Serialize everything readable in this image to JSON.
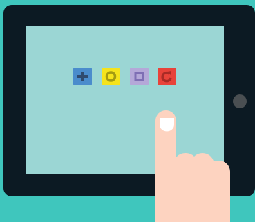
{
  "scene": {
    "background_color": "#3fc6bd",
    "tablet_color": "#0c1a23",
    "screen_color": "#9bd6d4",
    "home_button_color": "#4a4f52"
  },
  "app_icons": [
    {
      "name": "plus-icon",
      "bg": "#4a8ccc",
      "fg": "#2f4a6e"
    },
    {
      "name": "circle-icon",
      "bg": "#f5e31c",
      "fg": "#a39a12"
    },
    {
      "name": "square-icon",
      "bg": "#b4a8d8",
      "fg": "#7e6fb4"
    },
    {
      "name": "refresh-icon",
      "bg": "#e8433a",
      "fg": "#a92b26"
    }
  ],
  "hand": {
    "skin_color": "#fdd3c0",
    "nail_color": "#ffffff"
  }
}
